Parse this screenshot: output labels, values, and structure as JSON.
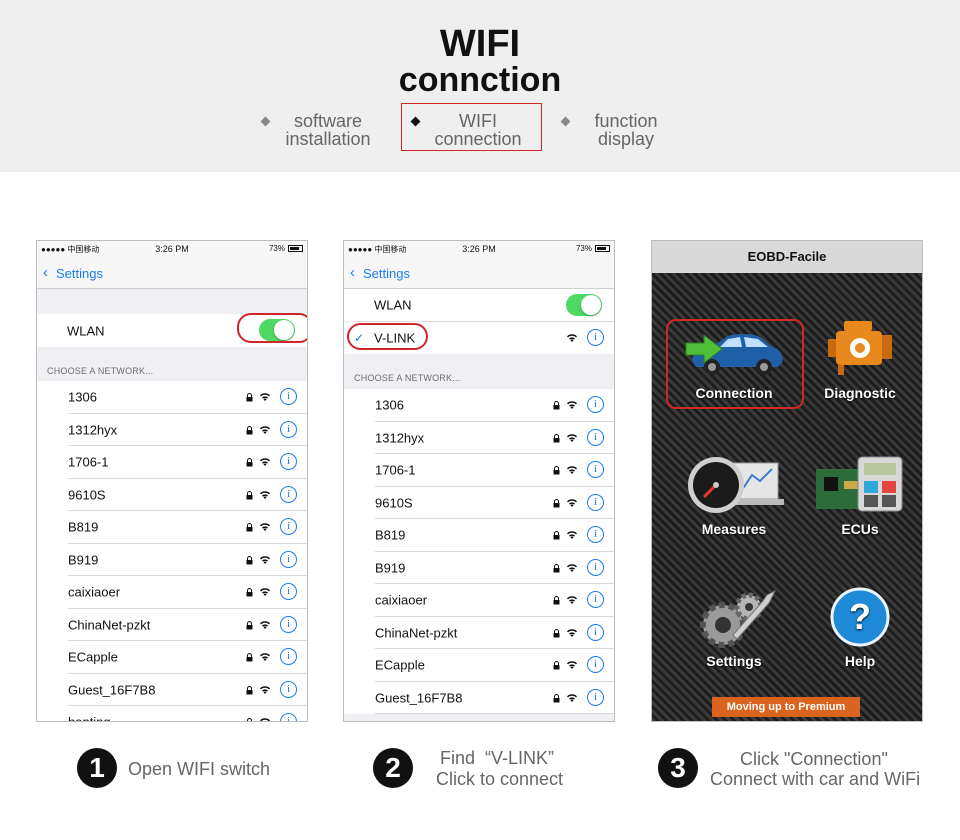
{
  "header": {
    "title_line1": "WIFI",
    "title_line2": "connction",
    "steps": [
      {
        "line1": "software",
        "line2": "installation",
        "active": false
      },
      {
        "line1": "WIFI",
        "line2": "connection",
        "active": true
      },
      {
        "line1": "function",
        "line2": "display",
        "active": false
      }
    ]
  },
  "phone1": {
    "carrier": "●●●●● 中国移动",
    "time": "3:26 PM",
    "battery": "73%",
    "back_label": "Settings",
    "wlan_label": "WLAN",
    "wlan_on": true,
    "section_label": "CHOOSE A NETWORK...",
    "networks": [
      "1306",
      "1312hyx",
      "1706-1",
      "9610S",
      "B819",
      "B919",
      "caixiaoer",
      "ChinaNet-pzkt",
      "ECapple",
      "Guest_16F7B8",
      "hanting"
    ]
  },
  "phone2": {
    "carrier": "●●●●● 中国移动",
    "time": "3:26 PM",
    "battery": "73%",
    "back_label": "Settings",
    "wlan_label": "WLAN",
    "wlan_on": true,
    "connected_network": "V-LINK",
    "section_label": "CHOOSE A NETWORK...",
    "networks": [
      "1306",
      "1312hyx",
      "1706-1",
      "9610S",
      "B819",
      "B919",
      "caixiaoer",
      "ChinaNet-pzkt",
      "ECapple",
      "Guest_16F7B8"
    ]
  },
  "app": {
    "title": "EOBD-Facile",
    "tiles": [
      {
        "label": "Connection",
        "icon": "car-connection-icon"
      },
      {
        "label": "Diagnostic",
        "icon": "engine-icon"
      },
      {
        "label": "Measures",
        "icon": "gauge-icon"
      },
      {
        "label": "ECUs",
        "icon": "ecu-calculator-icon"
      },
      {
        "label": "Settings",
        "icon": "gears-wrench-icon"
      },
      {
        "label": "Help",
        "icon": "help-icon"
      }
    ],
    "premium_button": "Moving up to Premium"
  },
  "captions": [
    {
      "number": "1",
      "line1": "Open WIFI switch",
      "line2": ""
    },
    {
      "number": "2",
      "line1": "Find  “V-LINK”",
      "line2": "Click to connect"
    },
    {
      "number": "3",
      "line1": "Click \"Connection\"",
      "line2": "Connect with car and WiFi"
    }
  ],
  "colors": {
    "accent_red": "#d0262a",
    "ios_blue": "#1a7cf5",
    "toggle_green": "#4cd964",
    "premium_orange": "#d9631f"
  }
}
